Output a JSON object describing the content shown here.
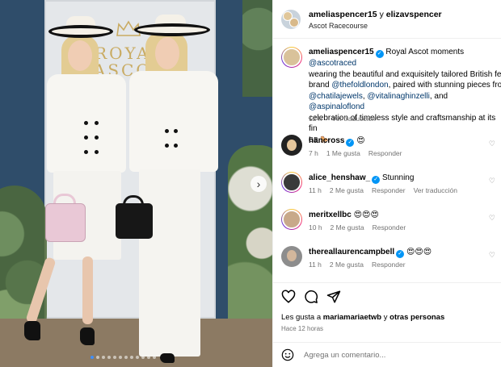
{
  "post": {
    "header_user1": "ameliaspencer15",
    "header_joiner": " y ",
    "header_user2": "elizavspencer",
    "location": "Ascot Racecourse"
  },
  "photo": {
    "sign_line1": "ROYAL",
    "sign_line2": "ASCOT",
    "carousel_dots": 12,
    "active_dot": 0
  },
  "caption": {
    "username": "ameliaspencer15",
    "part1": "Royal Ascot moments ",
    "mention1": "@ascotraced",
    "part2": "wearing the beautiful and exquisitely tailored British fe",
    "part3": "brand ",
    "mention2": "@thefoldlondon",
    "part4": ", paired with stunning pieces fro",
    "mention3": "@chatilajewels",
    "part5": ", ",
    "mention4": "@vitalinaghinzelli",
    "part6": ", and ",
    "mention5": "@aspinaloflond",
    "part7": "celebration of timeless style and craftsmanship at its fin",
    "flag_text": "GB",
    "time": "12 h",
    "translate": "Ver traducción"
  },
  "comments": [
    {
      "username": "hancross",
      "verified": true,
      "text": "😍",
      "time": "7 h",
      "likes": "1 Me gusta",
      "reply": "Responder",
      "translate": ""
    },
    {
      "username": "alice_henshaw_",
      "verified": true,
      "text": "Stunning",
      "time": "11 h",
      "likes": "2 Me gusta",
      "reply": "Responder",
      "translate": "Ver traducción"
    },
    {
      "username": "meritxellbc",
      "verified": false,
      "text": "😍😍😍",
      "time": "10 h",
      "likes": "2 Me gusta",
      "reply": "Responder",
      "translate": ""
    },
    {
      "username": "thereallaurencampbell",
      "verified": true,
      "text": "😍😍😍",
      "time": "11 h",
      "likes": "2 Me gusta",
      "reply": "Responder",
      "translate": ""
    }
  ],
  "likes": {
    "prefix": "Les gusta a ",
    "user": "mariamariaetwb",
    "joiner": " y ",
    "others": "otras personas",
    "time_ago": "Hace 12 horas"
  },
  "add_comment": {
    "placeholder": "Agrega un comentario..."
  },
  "icons": [
    "heart-icon",
    "comment-icon",
    "share-icon",
    "emoji-icon",
    "chevron-right-icon",
    "verified-icon"
  ],
  "colors": {
    "link": "#00376b",
    "verified": "#0095f6",
    "muted": "#737373",
    "dot_active": "#3f8ef7"
  }
}
